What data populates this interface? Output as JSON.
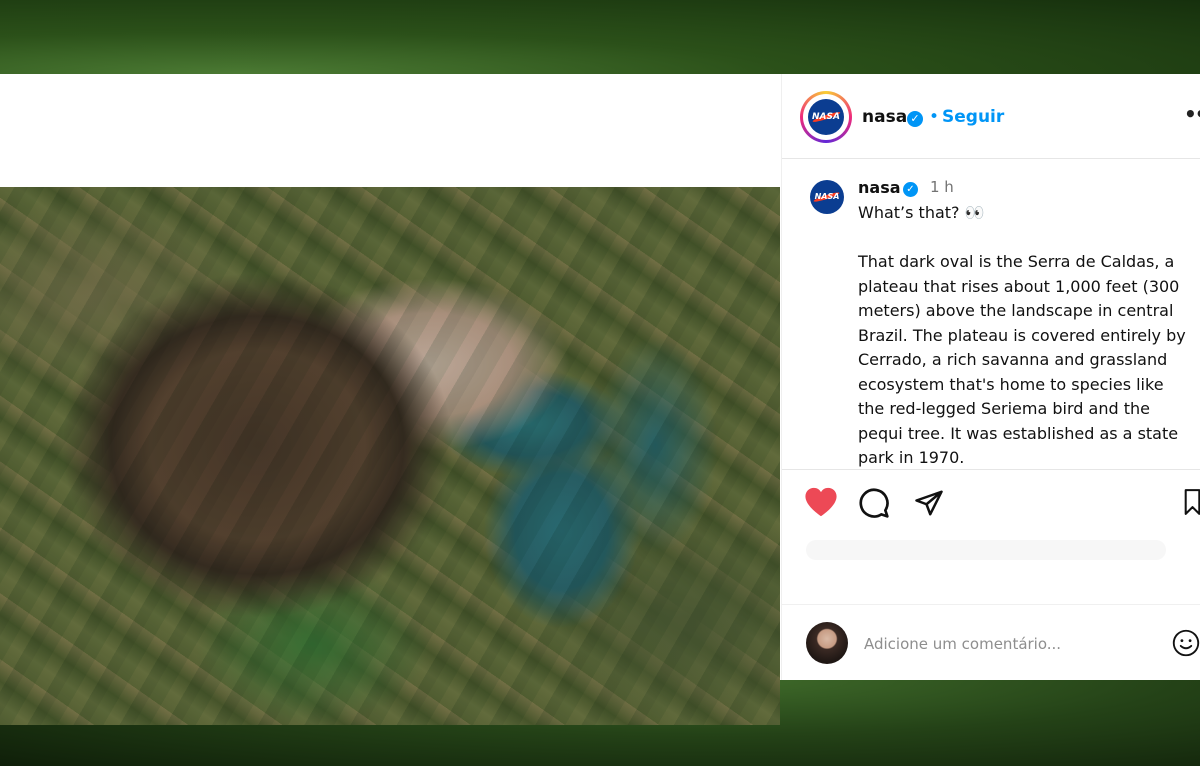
{
  "post": {
    "username": "nasa",
    "follow_label": "Seguir",
    "separator": "•",
    "more_label": "•••"
  },
  "caption": {
    "username": "nasa",
    "time": "1 h",
    "lead": "What’s that? 👀",
    "body": "That dark oval is the Serra de Caldas, a plateau that rises about 1,000 feet (300 meters) above the landscape in central Brazil. The plateau is covered entirely by Cerrado, a rich savanna and grassland ecosystem that's home to species like the red-legged Seriema bird and the pequi tree. It was established as a state park in 1970."
  },
  "logo_text": "NASA",
  "verified_glyph": "✓",
  "actions": {
    "like_icon": "heart-icon",
    "comment_icon": "comment-icon",
    "share_icon": "share-icon",
    "save_icon": "bookmark-icon",
    "liked": true
  },
  "comment_box": {
    "placeholder": "Adicione um comentário...",
    "emoji_icon": "emoji-icon"
  },
  "colors": {
    "like": "#ed4956",
    "link": "#0095f6",
    "text": "#111111",
    "muted": "#737373"
  }
}
